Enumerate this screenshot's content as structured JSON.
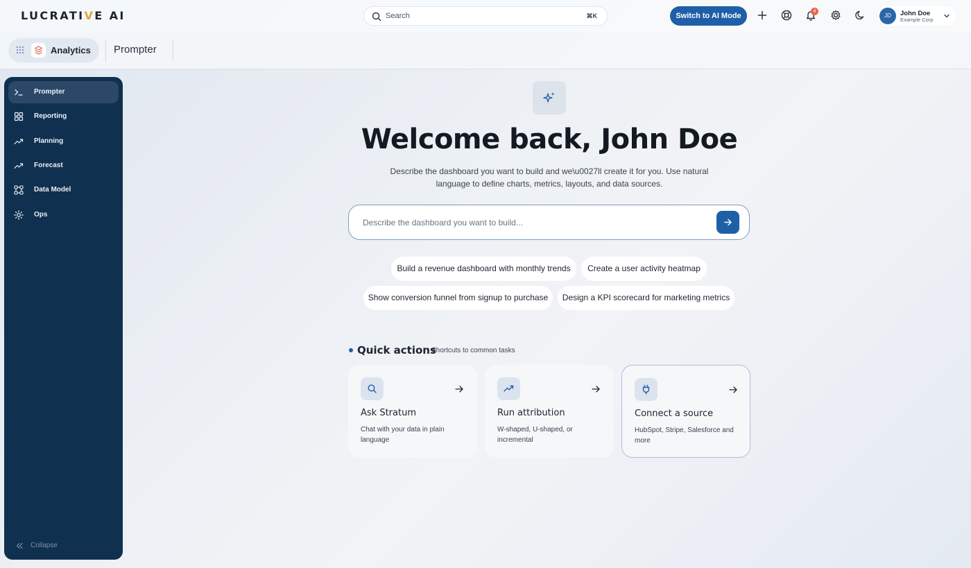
{
  "topbar": {
    "logo_text_a": "LUCRATI",
    "logo_text_v": "V",
    "logo_text_b": "E AI",
    "search_placeholder": "Search",
    "search_shortcut": "⌘K",
    "ai_mode_label": "Switch to AI Mode",
    "notification_count": "4",
    "user": {
      "initials": "JD",
      "name": "John Doe",
      "company": "Example Corp"
    }
  },
  "subbar": {
    "app_name": "Analytics",
    "breadcrumb": "Prompter"
  },
  "sidebar": {
    "items": [
      {
        "label": "Prompter",
        "icon": "terminal-icon",
        "active": true
      },
      {
        "label": "Reporting",
        "icon": "grid-icon"
      },
      {
        "label": "Planning",
        "icon": "trend-icon"
      },
      {
        "label": "Forecast",
        "icon": "trend-icon"
      },
      {
        "label": "Data Model",
        "icon": "nodes-icon"
      },
      {
        "label": "Ops",
        "icon": "sun-icon"
      }
    ],
    "collapse_label": "Collapse"
  },
  "main": {
    "title": "Welcome back, John Doe",
    "subtitle": "Describe the dashboard you want to build and we\\u0027ll create it for you. Use natural language to define charts, metrics, layouts, and data sources.",
    "prompt_placeholder": "Describe the dashboard you want to build...",
    "suggestions": [
      "Build a revenue dashboard with monthly trends",
      "Create a user activity heatmap",
      "Show conversion funnel from signup to purchase",
      "Design a KPI scorecard for marketing metrics"
    ],
    "quick_actions": {
      "title": "Quick actions",
      "subtitle": "Shortcuts to common tasks",
      "cards": [
        {
          "title": "Ask Stratum",
          "desc": "Chat with your data in plain language",
          "icon": "search-icon"
        },
        {
          "title": "Run attribution",
          "desc": "W-shaped, U-shaped, or incremental",
          "icon": "trend-icon"
        },
        {
          "title": "Connect a source",
          "desc": "HubSpot, Stripe, Salesforce and more",
          "icon": "plug-icon"
        }
      ]
    }
  },
  "colors": {
    "accent": "#1f5fa8",
    "sidebar": "#10304f",
    "badge": "#e8684a",
    "logo_v": "#e0a43a"
  }
}
